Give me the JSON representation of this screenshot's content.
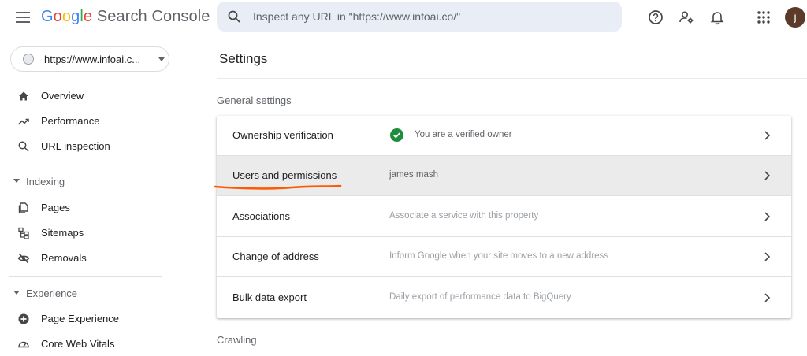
{
  "header": {
    "logo_letters": [
      "G",
      "o",
      "o",
      "g",
      "l",
      "e"
    ],
    "logo_rest": " Search Console",
    "search_placeholder": "Inspect any URL in \"https://www.infoai.co/\"",
    "avatar_letter": "j"
  },
  "sidebar": {
    "property": "https://www.infoai.c...",
    "items_top": [
      {
        "label": "Overview",
        "icon": "home-icon"
      },
      {
        "label": "Performance",
        "icon": "trending-up-icon"
      },
      {
        "label": "URL inspection",
        "icon": "search-icon"
      }
    ],
    "indexing": {
      "header": "Indexing",
      "items": [
        {
          "label": "Pages",
          "icon": "pages-icon"
        },
        {
          "label": "Sitemaps",
          "icon": "sitemap-icon"
        },
        {
          "label": "Removals",
          "icon": "removals-icon"
        }
      ]
    },
    "experience": {
      "header": "Experience",
      "items": [
        {
          "label": "Page Experience",
          "icon": "page-experience-icon"
        },
        {
          "label": "Core Web Vitals",
          "icon": "gauge-icon"
        }
      ]
    }
  },
  "main": {
    "title": "Settings",
    "general_label": "General settings",
    "rows": [
      {
        "label": "Ownership verification",
        "desc": "You are a verified owner"
      },
      {
        "label": "Users and permissions",
        "desc": "james mash"
      },
      {
        "label": "Associations",
        "desc": "Associate a service with this property"
      },
      {
        "label": "Change of address",
        "desc": "Inform Google when your site moves to a new address"
      },
      {
        "label": "Bulk data export",
        "desc": "Daily export of performance data to BigQuery"
      }
    ],
    "crawling_label": "Crawling"
  },
  "colors": {
    "accent_blue": "#4285F4",
    "verified_green": "#1e8e3e",
    "annotation_orange": "#ff5a00",
    "row_highlight": "#ebebeb"
  }
}
